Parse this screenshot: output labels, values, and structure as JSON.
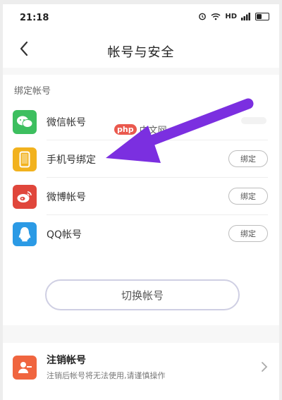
{
  "status_bar": {
    "time": "21:18",
    "network": "HD"
  },
  "header": {
    "title": "帐号与安全"
  },
  "bound_accounts": {
    "section_title": "绑定帐号",
    "items": [
      {
        "label": "微信帐号",
        "icon": "wechat-icon",
        "color": "#3dbf5f",
        "button": ""
      },
      {
        "label": "手机号绑定",
        "icon": "phone-icon",
        "color": "#f2b21e",
        "button": "绑定"
      },
      {
        "label": "微博帐号",
        "icon": "weibo-icon",
        "color": "#e0463b",
        "button": "绑定"
      },
      {
        "label": "QQ帐号",
        "icon": "qq-icon",
        "color": "#2b9ae5",
        "button": "绑定"
      }
    ],
    "switch_button": "切换帐号"
  },
  "watermark": {
    "badge": "php",
    "text": "中文网"
  },
  "cancel_account": {
    "title": "注销帐号",
    "subtitle": "注销后帐号将无法使用,请谨慎操作"
  },
  "colors": {
    "annotation_arrow": "#7b2fe0",
    "accent_orange": "#f0653f"
  }
}
